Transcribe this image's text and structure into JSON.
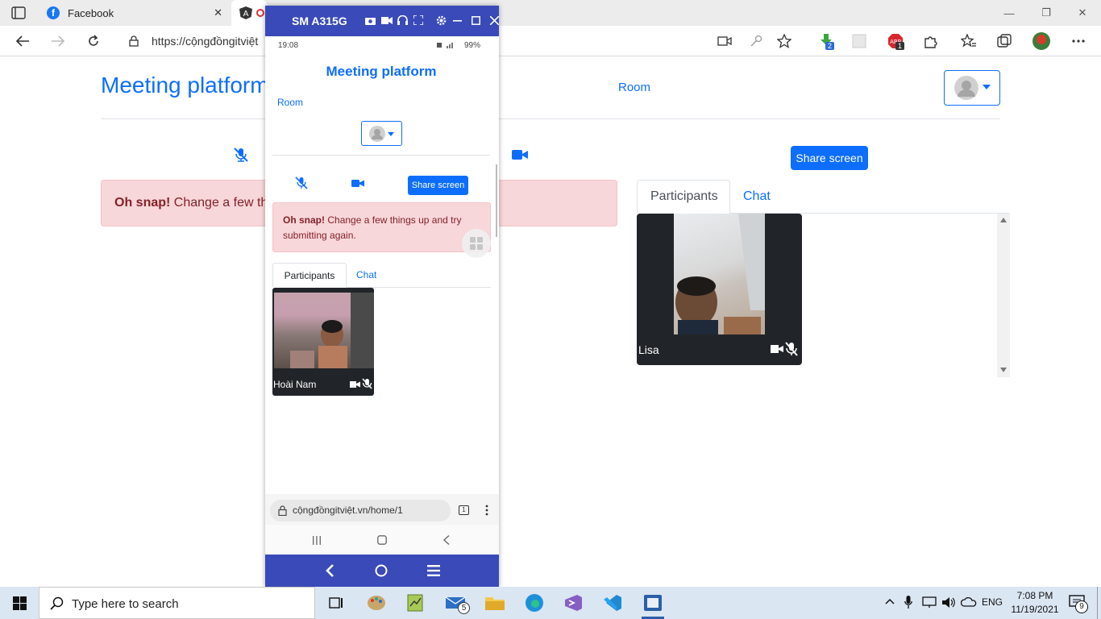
{
  "browser": {
    "tabs": [
      {
        "label": "Facebook"
      }
    ],
    "url": "https://cộngđồngitviệt",
    "extension_badges": {
      "downloads": "2",
      "abp": "1"
    }
  },
  "page": {
    "title": "Meeting platform",
    "nav_room": "Room",
    "share_button": "Share screen",
    "alert_bold": "Oh snap!",
    "alert_text": "Change a few th",
    "tabs": {
      "participants": "Participants",
      "chat": "Chat"
    },
    "participant": {
      "name": "Lisa"
    }
  },
  "phone": {
    "window_title": "SM A315G",
    "status_time": "19:08",
    "battery": "99%",
    "heading": "Meeting platform",
    "room": "Room",
    "share_button": "Share screen",
    "alert_bold": "Oh snap!",
    "alert_text": "Change a few things up and try submitting again.",
    "tabs": {
      "participants": "Participants",
      "chat": "Chat"
    },
    "participant": {
      "name": "Hoài Nam"
    },
    "url": "cộngđồngitviệt.vn/home/1",
    "tab_count": "1"
  },
  "taskbar": {
    "search_placeholder": "Type here to search",
    "mail_badge": "5",
    "language": "ENG",
    "time": "7:08 PM",
    "date": "11/19/2021",
    "notification_count": "9"
  },
  "colors": {
    "accent": "#0d6efd",
    "alert_bg": "#f8d7da",
    "alert_text": "#842029",
    "phone_frame": "#3a4ab8"
  }
}
